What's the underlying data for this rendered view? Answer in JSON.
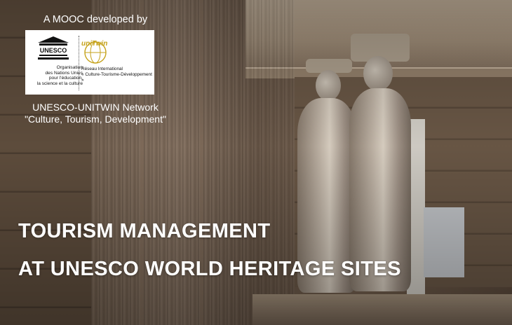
{
  "header": {
    "tagline": "A MOOC developed by"
  },
  "logos": {
    "unesco": {
      "wordmark": "UNESCO",
      "lines": [
        "Organisation",
        "des Nations Unies",
        "pour l'éducation,",
        "la science et la culture"
      ]
    },
    "unitwin": {
      "wordmark": "uniTwin",
      "lines": [
        "Réseau International",
        "« Culture-Tourisme-Développement »"
      ],
      "color": "#c5a21a"
    }
  },
  "network": {
    "line1": "UNESCO-UNITWIN Network",
    "line2": "\"Culture, Tourism, Development\""
  },
  "title": {
    "line1": "TOURISM MANAGEMENT",
    "line2": "AT UNESCO WORLD HERITAGE SITES"
  }
}
